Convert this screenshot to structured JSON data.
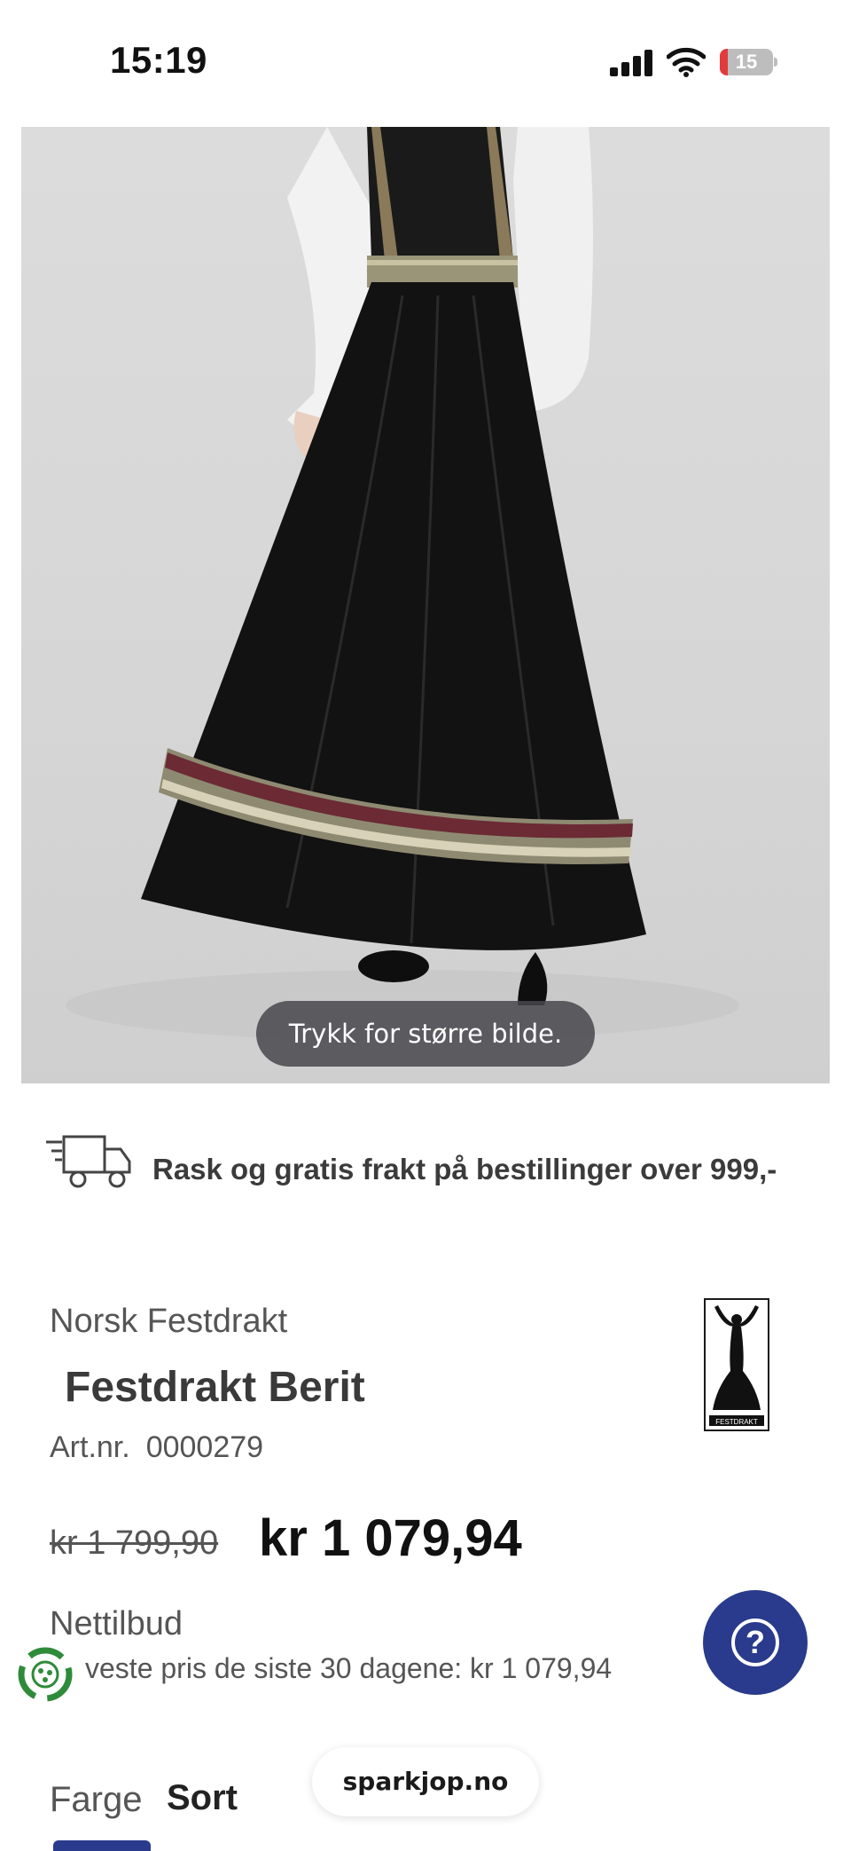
{
  "status_bar": {
    "time": "15:19",
    "battery_level": "15"
  },
  "product_image": {
    "hint": "Trykk for større bilde."
  },
  "shipping": {
    "text": "Rask og gratis frakt på bestillinger over 999,-"
  },
  "product": {
    "brand": "Norsk Festdrakt",
    "name": "Festdrakt Berit",
    "art_label": "Art.nr.",
    "art_number": "0000279",
    "old_price": "kr 1 799,90",
    "price": "kr 1 079,94",
    "offer_label": "Nettilbud",
    "lowest_price_text": "veste pris de siste 30 dagene: kr 1 079,94",
    "color_label": "Farge",
    "color_value": "Sort"
  },
  "brand_logo": {
    "text": "FESTDRAKT"
  },
  "footer": {
    "domain": "sparkjop.no"
  },
  "colors": {
    "accent": "#2a3a8c",
    "battery_low": "#e23b3b",
    "recycle_green": "#2e8b3a"
  }
}
